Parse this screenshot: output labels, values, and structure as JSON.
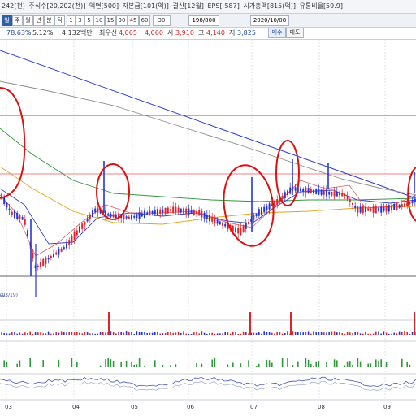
{
  "info_bar": {
    "items": [
      "242(천)",
      "주식수[20,202(천)]",
      "액면[500]",
      "자본금[101(억)]",
      "결산[12월]",
      "EPS[-587]",
      "시가총액[815(억)]",
      "유통비율[59.9]"
    ]
  },
  "toolbar": {
    "periods": [
      {
        "label": "일",
        "active": true
      },
      {
        "label": "주",
        "active": false
      },
      {
        "label": "월",
        "active": false
      },
      {
        "label": "년",
        "active": false
      },
      {
        "label": "분",
        "active": false
      },
      {
        "label": "틱",
        "active": false
      },
      {
        "label": "1",
        "active": false
      },
      {
        "label": "3",
        "active": false
      },
      {
        "label": "5",
        "active": false
      },
      {
        "label": "10",
        "active": false
      },
      {
        "label": "15",
        "active": false
      },
      {
        "label": "30",
        "active": false
      },
      {
        "label": "45",
        "active": false
      },
      {
        "label": "60",
        "active": false
      },
      {
        "label": "30",
        "active": false
      }
    ],
    "count": "198/800",
    "date": "2020/10/08"
  },
  "price_bar": {
    "change_pct": "78.63%",
    "rate": "5.12%",
    "volume": "4,132백만",
    "option": "최우선",
    "open_label": "시",
    "high_label": "고",
    "low_label": "저",
    "v1": "4,065",
    "v2": "4,060",
    "open": "3,910",
    "high": "4,140",
    "low": "3,825",
    "sell_label": "매수",
    "buy_label": "매도"
  },
  "chart_data": {
    "type": "candlestick",
    "x_labels": [
      "03",
      "04",
      "05",
      "06",
      "07",
      "08",
      "09"
    ],
    "low_annotation": "(03/19)",
    "colors": {
      "up": "#e0242b",
      "down": "#2435d8",
      "ma5": "#e25858",
      "ma20": "#3a46c6",
      "ma60": "#e8a21a",
      "ma120": "#2e9a3a",
      "ma240": "#8a8a8a",
      "trend": "#2f3fd0",
      "resist": "#f08080",
      "annotation": "#e01010"
    }
  }
}
